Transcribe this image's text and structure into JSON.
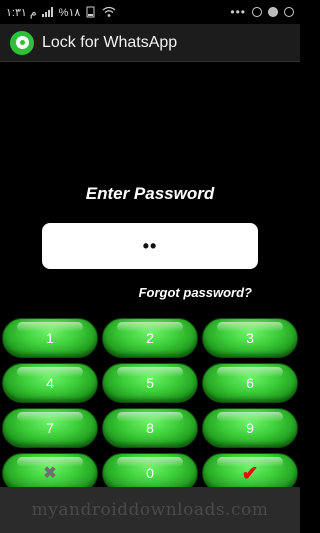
{
  "status_bar": {
    "left_text": "م ١:٣١",
    "battery": "%١٨"
  },
  "app_bar": {
    "title": "Lock for WhatsApp"
  },
  "lock_screen": {
    "prompt": "Enter Password",
    "password_value": "••",
    "forgot_link": "Forgot password?"
  },
  "keypad": {
    "keys": [
      "1",
      "2",
      "3",
      "4",
      "5",
      "6",
      "7",
      "8",
      "9"
    ],
    "clear_icon": "✖",
    "zero": "0",
    "ok_icon": "✔"
  },
  "watermark": "myandroiddownloads.com",
  "colors": {
    "key_green": "#3fcf3b",
    "ok_red": "#e01010",
    "app_bar": "#1c1c1c"
  }
}
